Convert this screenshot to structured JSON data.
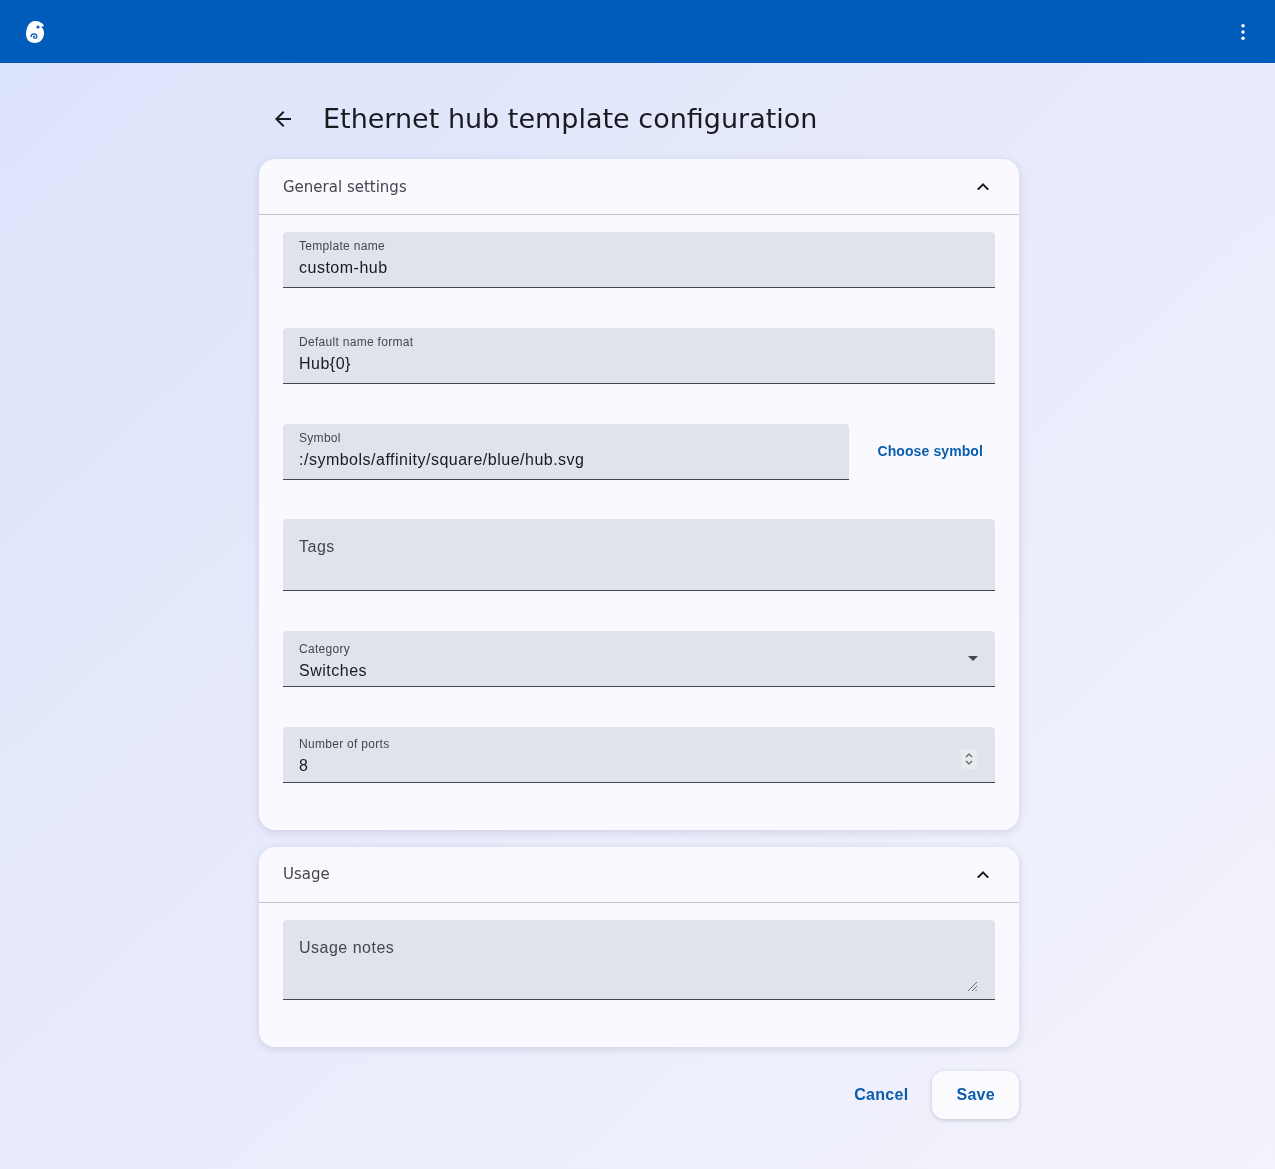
{
  "page_title": "Ethernet hub template configuration",
  "sections": [
    {
      "title": "General settings",
      "expanded": true,
      "fields": [
        {
          "kind": "text",
          "label": "Template name",
          "value": "custom-hub"
        },
        {
          "kind": "text",
          "label": "Default name format",
          "value": "Hub{0}"
        },
        {
          "kind": "text",
          "label": "Symbol",
          "value": ":/symbols/affinity/square/blue/hub.svg",
          "button": "Choose symbol"
        },
        {
          "kind": "chips",
          "label": "Tags"
        },
        {
          "kind": "select",
          "label": "Category",
          "value": "Switches"
        },
        {
          "kind": "number",
          "label": "Number of ports",
          "value": "8"
        }
      ]
    },
    {
      "title": "Usage",
      "expanded": true,
      "fields": [
        {
          "kind": "textarea",
          "label": "Usage notes"
        }
      ]
    }
  ],
  "actions": [
    {
      "kind": "text",
      "label": "Cancel"
    },
    {
      "kind": "raised",
      "label": "Save"
    }
  ]
}
